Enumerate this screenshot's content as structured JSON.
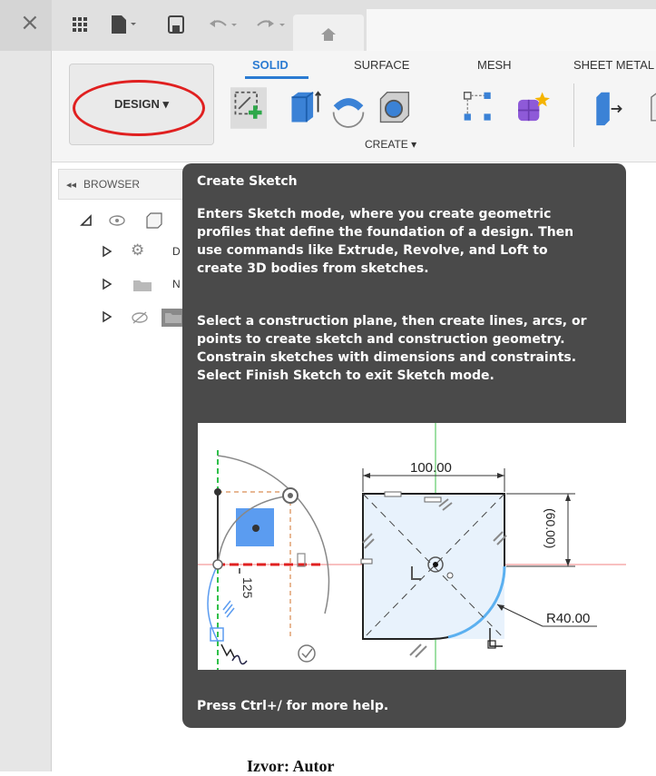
{
  "window": {
    "close_glyph": "×"
  },
  "toolbar": {
    "design_label": "DESIGN ▾",
    "tabs": [
      {
        "label": "SOLID"
      },
      {
        "label": "SURFACE"
      },
      {
        "label": "MESH"
      },
      {
        "label": "SHEET METAL"
      }
    ],
    "create_label": "CREATE ▾",
    "accent_color": "#2b7bd2"
  },
  "browser": {
    "header_label": "BROWSER",
    "items": [
      {
        "label": "D"
      },
      {
        "label": "N"
      }
    ]
  },
  "tooltip": {
    "title": "Create Sketch",
    "paragraph1": [
      "Enters Sketch mode, where you create geometric",
      "profiles that define the foundation of a design. Then",
      "use commands like Extrude, Revolve, and Loft to",
      "create 3D bodies from sketches."
    ],
    "paragraph2": [
      "Select a construction plane, then create lines, arcs, or",
      "points to create sketch and construction geometry.",
      "Constrain sketches with dimensions and constraints.",
      "Select Finish Sketch to exit Sketch mode."
    ],
    "illustration": {
      "dim_top": "100.00",
      "dim_side": "(60.00)",
      "dim_radius": "R40.00",
      "dim_left": "125"
    },
    "footer": "Press Ctrl+/ for more help."
  },
  "caption": "Izvor: Autor"
}
